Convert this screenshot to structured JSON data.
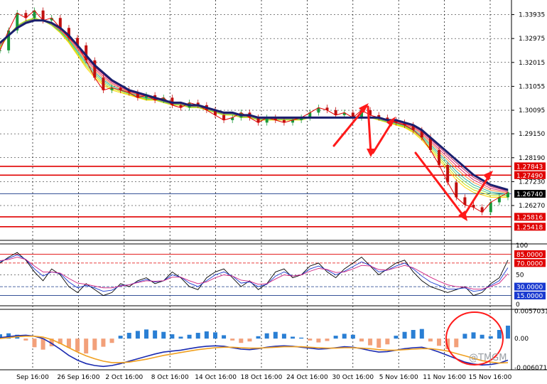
{
  "chart_data": [
    {
      "type": "line",
      "panel": "price",
      "yticks": [
        "1.33935",
        "1.32975",
        "1.32015",
        "1.31055",
        "1.30095",
        "1.29150",
        "1.28190",
        "1.27230",
        "1.26270"
      ],
      "ylim": [
        1.251,
        1.3435
      ],
      "xticks": [
        "Sep 16:00",
        "26 Sep 16:00",
        "2 Oct 16:00",
        "8 Oct 16:00",
        "14 Oct 16:00",
        "18 Oct 16:00",
        "24 Oct 16:00",
        "30 Oct 16:00",
        "5 Nov 16:00",
        "11 Nov 16:00",
        "15 Nov 16:00"
      ],
      "levels": [
        {
          "label": "1.27843",
          "value": 1.27843,
          "color": "#e00000"
        },
        {
          "label": "1.27490",
          "value": 1.2749,
          "color": "#e00000"
        },
        {
          "label": "1.26740",
          "value": 1.2674,
          "color": "#1a3a8a"
        },
        {
          "label": "1.25816",
          "value": 1.25816,
          "color": "#e00000"
        },
        {
          "label": "1.25418",
          "value": 1.25418,
          "color": "#e00000"
        }
      ],
      "series": [
        {
          "values": [
            1.325,
            1.333,
            1.34,
            1.338,
            1.341,
            1.337,
            1.338,
            1.334,
            1.33,
            1.327,
            1.321,
            1.314,
            1.309,
            1.31,
            1.309,
            1.308,
            1.306,
            1.307,
            1.305,
            1.306,
            1.303,
            1.302,
            1.304,
            1.303,
            1.301,
            1.299,
            1.297,
            1.298,
            1.3,
            1.298,
            1.296,
            1.298,
            1.297,
            1.296,
            1.297,
            1.298,
            1.3,
            1.302,
            1.301,
            1.299,
            1.3,
            1.298,
            1.301,
            1.299,
            1.298,
            1.297,
            1.296,
            1.295,
            1.293,
            1.29,
            1.285,
            1.279,
            1.272,
            1.266,
            1.263,
            1.262,
            1.26,
            1.264,
            1.266,
            1.268
          ]
        },
        {
          "values": [
            1.326,
            1.331,
            1.335,
            1.337,
            1.338,
            1.337,
            1.335,
            1.332,
            1.328,
            1.323,
            1.318,
            1.314,
            1.311,
            1.309,
            1.308,
            1.307,
            1.306,
            1.305,
            1.305,
            1.304,
            1.303,
            1.303,
            1.302,
            1.302,
            1.301,
            1.3,
            1.299,
            1.299,
            1.298,
            1.298,
            1.297,
            1.297,
            1.297,
            1.297,
            1.297,
            1.297,
            1.298,
            1.298,
            1.298,
            1.298,
            1.298,
            1.298,
            1.298,
            1.298,
            1.297,
            1.296,
            1.295,
            1.294,
            1.292,
            1.289,
            1.285,
            1.281,
            1.277,
            1.273,
            1.27,
            1.268,
            1.267,
            1.266,
            1.266,
            1.266
          ]
        },
        {
          "values": [
            1.328,
            1.331,
            1.334,
            1.336,
            1.337,
            1.337,
            1.336,
            1.334,
            1.331,
            1.327,
            1.323,
            1.319,
            1.316,
            1.313,
            1.311,
            1.309,
            1.308,
            1.307,
            1.306,
            1.305,
            1.304,
            1.304,
            1.303,
            1.303,
            1.302,
            1.301,
            1.3,
            1.3,
            1.299,
            1.299,
            1.298,
            1.298,
            1.298,
            1.298,
            1.298,
            1.298,
            1.298,
            1.298,
            1.298,
            1.298,
            1.298,
            1.298,
            1.298,
            1.298,
            1.298,
            1.297,
            1.297,
            1.296,
            1.295,
            1.293,
            1.29,
            1.287,
            1.284,
            1.281,
            1.278,
            1.275,
            1.273,
            1.271,
            1.27,
            1.269
          ]
        }
      ]
    },
    {
      "type": "line",
      "panel": "oscillator",
      "yticks": [
        "100",
        "50",
        "0"
      ],
      "ylim": [
        0,
        100
      ],
      "levels": [
        {
          "label": "85.0000",
          "value": 85,
          "color": "#e00000"
        },
        {
          "label": "70.0000",
          "value": 70,
          "color": "#e00000"
        },
        {
          "label": "30.0000",
          "value": 30,
          "color": "#1a3a8a"
        },
        {
          "label": "15.0000",
          "value": 15,
          "color": "#1a3a8a"
        }
      ],
      "series": [
        {
          "values": [
            70,
            80,
            88,
            75,
            55,
            40,
            60,
            50,
            30,
            20,
            35,
            25,
            15,
            20,
            35,
            30,
            40,
            45,
            35,
            40,
            55,
            45,
            30,
            25,
            45,
            55,
            60,
            45,
            30,
            40,
            25,
            35,
            55,
            60,
            45,
            50,
            65,
            70,
            55,
            45,
            60,
            70,
            80,
            65,
            50,
            60,
            70,
            75,
            55,
            40,
            30,
            25,
            20,
            25,
            30,
            15,
            20,
            35,
            45,
            75
          ]
        },
        {
          "values": [
            72,
            78,
            84,
            76,
            60,
            48,
            55,
            52,
            38,
            28,
            32,
            28,
            22,
            24,
            32,
            33,
            38,
            42,
            38,
            40,
            50,
            46,
            36,
            30,
            40,
            50,
            55,
            48,
            36,
            38,
            30,
            34,
            48,
            55,
            48,
            50,
            60,
            65,
            58,
            50,
            56,
            64,
            72,
            66,
            55,
            58,
            65,
            70,
            60,
            48,
            38,
            32,
            26,
            26,
            28,
            22,
            24,
            32,
            40,
            62
          ]
        },
        {
          "values": [
            74,
            76,
            80,
            76,
            65,
            55,
            55,
            53,
            44,
            36,
            34,
            31,
            28,
            28,
            31,
            33,
            37,
            40,
            39,
            40,
            46,
            46,
            40,
            35,
            38,
            45,
            50,
            48,
            41,
            39,
            34,
            35,
            43,
            50,
            48,
            50,
            56,
            61,
            59,
            54,
            55,
            60,
            66,
            65,
            59,
            58,
            62,
            66,
            62,
            54,
            46,
            39,
            33,
            30,
            29,
            26,
            26,
            30,
            36,
            52
          ]
        }
      ]
    },
    {
      "type": "bar",
      "panel": "histogram",
      "yticks": [
        "0.0057031",
        "0.00",
        "-0.006071"
      ],
      "ylim": [
        -0.0062,
        0.0058
      ],
      "values": [
        0.0009,
        0.0011,
        0.0008,
        -0.0004,
        -0.0018,
        -0.0023,
        -0.0016,
        -0.0011,
        -0.0019,
        -0.0027,
        -0.0031,
        -0.0024,
        -0.0017,
        -0.0009,
        0.0006,
        0.0012,
        0.0016,
        0.0019,
        0.0017,
        0.0014,
        0.0009,
        0.0004,
        0.0008,
        0.0012,
        0.0015,
        0.0013,
        0.0007,
        -0.0004,
        -0.0009,
        -0.0006,
        0.0005,
        0.0011,
        0.0014,
        0.001,
        0.0004,
        0.0002,
        -0.0004,
        -0.0008,
        -0.0005,
        0.0006,
        0.001,
        0.0008,
        -0.0006,
        -0.0014,
        -0.0019,
        -0.0012,
        0.0006,
        0.0014,
        0.0018,
        0.002,
        -0.0006,
        -0.0015,
        -0.0022,
        -0.0018,
        0.001,
        0.0013,
        0.0008,
        0.0005,
        0.0018,
        0.0027
      ],
      "series": [
        {
          "values": [
            0.0002,
            0.0004,
            0.0006,
            0.0007,
            0.0005,
            0.0,
            -0.001,
            -0.0022,
            -0.0035,
            -0.0045,
            -0.0052,
            -0.0056,
            -0.0058,
            -0.0056,
            -0.0052,
            -0.0047,
            -0.0042,
            -0.0037,
            -0.0032,
            -0.0028,
            -0.0026,
            -0.0024,
            -0.0021,
            -0.0018,
            -0.0016,
            -0.0015,
            -0.0016,
            -0.0019,
            -0.0022,
            -0.0023,
            -0.0021,
            -0.0018,
            -0.0016,
            -0.0015,
            -0.0016,
            -0.0018,
            -0.002,
            -0.0022,
            -0.0021,
            -0.0019,
            -0.0017,
            -0.0018,
            -0.0021,
            -0.0025,
            -0.0028,
            -0.0027,
            -0.0024,
            -0.0021,
            -0.0019,
            -0.0018,
            -0.0022,
            -0.0028,
            -0.0035,
            -0.0042,
            -0.0049,
            -0.0053,
            -0.0055,
            -0.0054,
            -0.0051,
            -0.0045
          ]
        },
        {
          "values": [
            0.0,
            0.0002,
            0.0004,
            0.0005,
            0.0005,
            0.0003,
            -0.0002,
            -0.001,
            -0.0019,
            -0.0028,
            -0.0036,
            -0.0042,
            -0.0047,
            -0.005,
            -0.005,
            -0.0049,
            -0.0046,
            -0.0043,
            -0.0039,
            -0.0035,
            -0.0032,
            -0.0029,
            -0.0026,
            -0.0023,
            -0.0021,
            -0.0019,
            -0.0018,
            -0.0018,
            -0.0019,
            -0.002,
            -0.002,
            -0.0019,
            -0.0018,
            -0.0017,
            -0.0017,
            -0.0017,
            -0.0018,
            -0.0019,
            -0.002,
            -0.002,
            -0.0019,
            -0.0019,
            -0.002,
            -0.0021,
            -0.0023,
            -0.0024,
            -0.0024,
            -0.0023,
            -0.0022,
            -0.0021,
            -0.0021,
            -0.0023,
            -0.0026,
            -0.0031,
            -0.0036,
            -0.0041,
            -0.0046,
            -0.0049,
            -0.0051,
            -0.005
          ]
        }
      ]
    }
  ],
  "watermark": "@TMGM"
}
